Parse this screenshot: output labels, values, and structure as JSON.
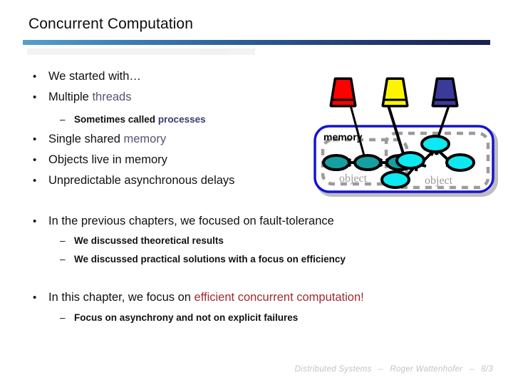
{
  "slide": {
    "title": "Concurrent Computation",
    "accent_gradient_from": "#55a0cc",
    "accent_gradient_to": "#19224f",
    "keyword_color": "#53556f",
    "emphasis_color": "#9e2a2b"
  },
  "bullets": {
    "l1_a": "We started with…",
    "l2_a_pre": "Multiple ",
    "l2_a_kw": "threads",
    "l2_sub": "Sometimes called ",
    "l2_sub_kw": "processes",
    "l3_pre": "Single shared ",
    "l3_kw": "memory",
    "l4": "Objects live in memory",
    "l5": "Unpredictable asynchronous delays",
    "l6": "In the previous chapters, we focused on fault-tolerance",
    "l6_sub1": "We discussed theoretical results",
    "l6_sub2": "We discussed practical solutions with a focus on efficiency",
    "l7_pre": "In this chapter, we focus on ",
    "l7_em": "efficient concurrent computation",
    "l7_post": "!",
    "l7_sub": "Focus on asynchrony and not  on explicit failures",
    "bullet_marker": "•",
    "dash_marker": "–"
  },
  "diagram": {
    "memory_label": "memory",
    "object_label_left": "object",
    "object_label_right": "object",
    "threads": [
      {
        "name": "thread-red",
        "color": "#fe0000"
      },
      {
        "name": "thread-yellow",
        "color": "#fdf500"
      },
      {
        "name": "thread-blue",
        "color": "#3a3a9c"
      }
    ],
    "object_left_node_color": "#14a0a0",
    "object_right_node_color": "#0ee8f0",
    "memory_border_color": "#1414d2",
    "object_border_color": "#9b9b9b",
    "object_label_color": "#9b9b9b"
  },
  "footer": {
    "course": "Distributed Systems",
    "sep1": "–",
    "author": "Roger Wattenhofer",
    "sep2": "–",
    "page": "8/3"
  }
}
